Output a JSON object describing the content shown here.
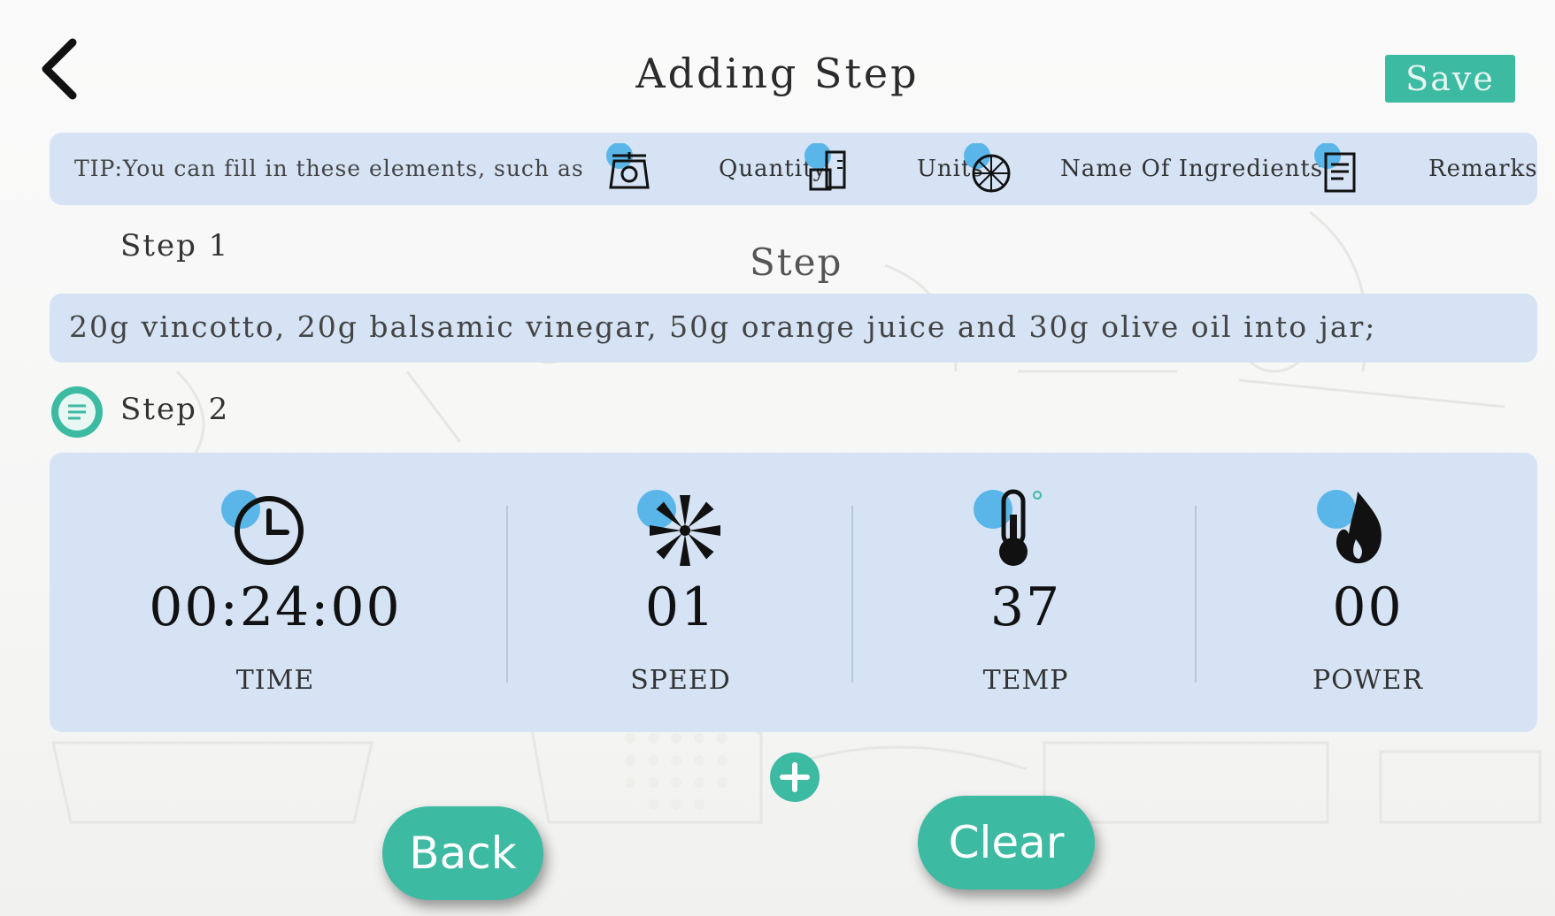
{
  "header": {
    "title": "Adding Step",
    "save_label": "Save"
  },
  "tip": {
    "text": "TIP:You can fill in these elements, such as",
    "items": [
      {
        "label": "Quantity",
        "icon": "scale-icon"
      },
      {
        "label": "Units",
        "icon": "measuring-cup-icon"
      },
      {
        "label": "Name Of Ingredients",
        "icon": "ingredient-icon"
      },
      {
        "label": "Remarks",
        "icon": "notes-icon"
      }
    ]
  },
  "step1": {
    "label": "Step 1",
    "placeholder": "Step",
    "text": "20g vincotto, 20g balsamic vinegar, 50g orange juice and 30g olive oil into jar;"
  },
  "step2": {
    "label": "Step 2",
    "params": [
      {
        "value": "00:24:00",
        "label": "TIME",
        "icon": "clock-icon"
      },
      {
        "value": "01",
        "label": "SPEED",
        "icon": "blade-icon"
      },
      {
        "value": "37",
        "label": "TEMP",
        "icon": "thermometer-icon"
      },
      {
        "value": "00",
        "label": "POWER",
        "icon": "flame-icon"
      }
    ]
  },
  "actions": {
    "add_icon": "plus-icon",
    "back_label": "Back",
    "clear_label": "Clear"
  },
  "colors": {
    "accent": "#3dbaa2",
    "panel": "#d5e3f5",
    "icon_bubble": "#5ab6e8"
  }
}
